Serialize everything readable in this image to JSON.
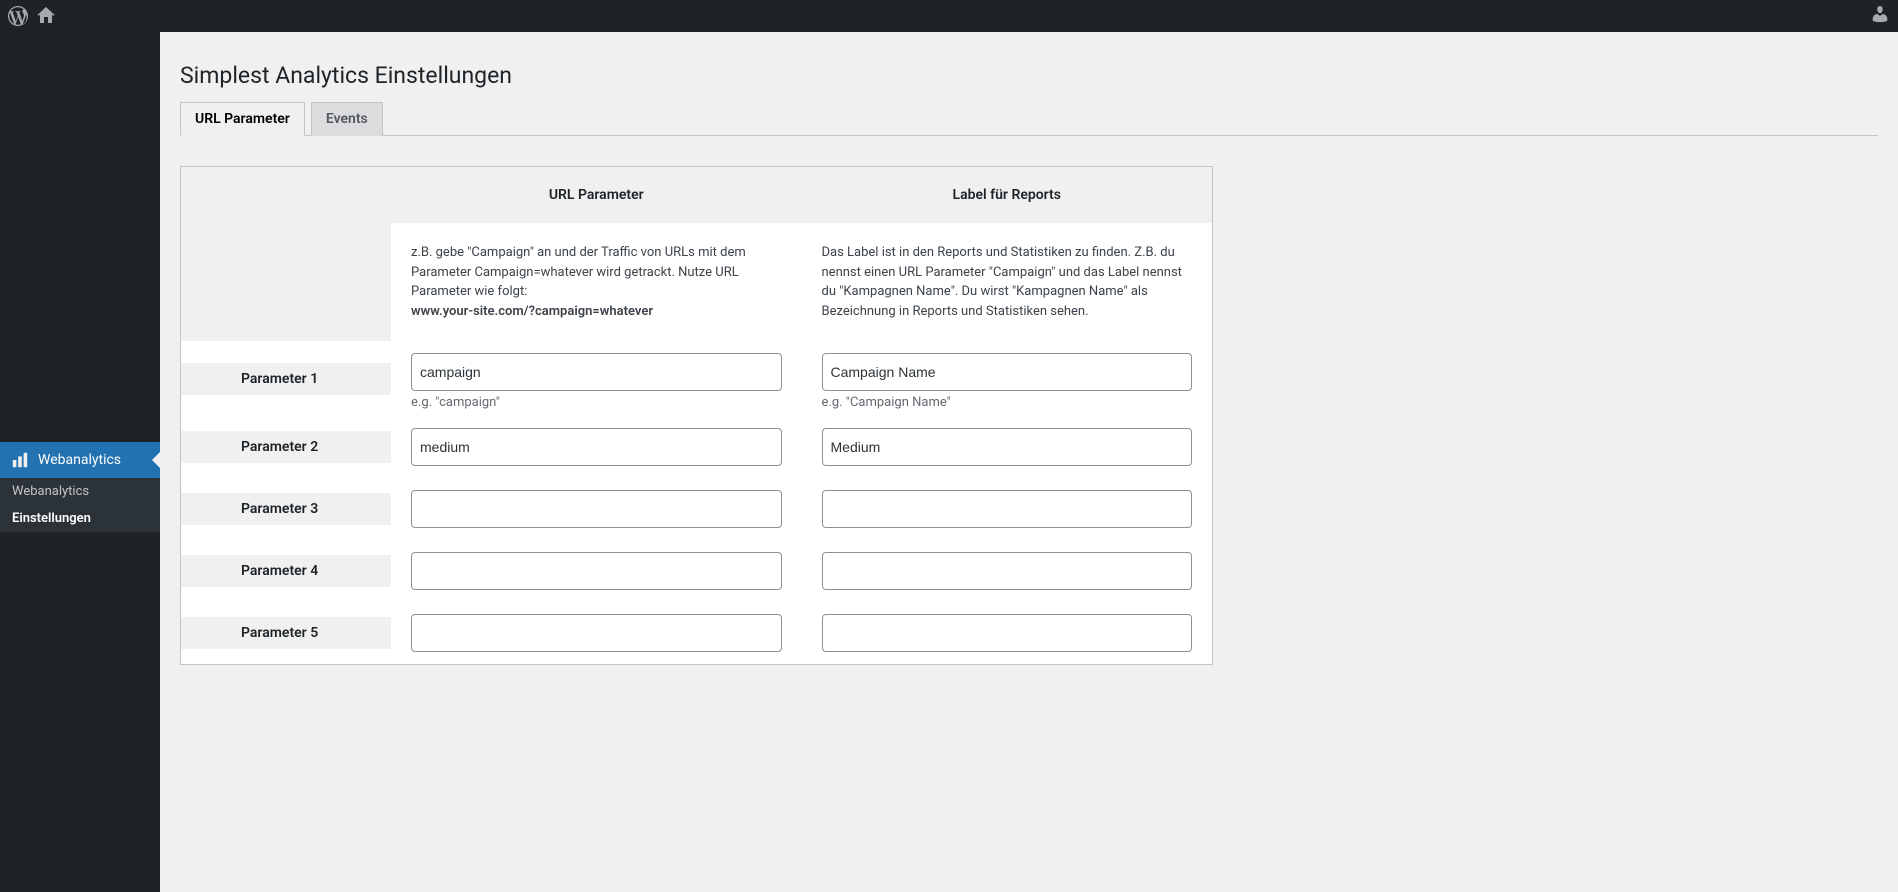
{
  "adminbar": {
    "wordpress_icon": "wordpress-logo-icon",
    "home_icon": "home-icon",
    "user_icon": "user-icon"
  },
  "sidebar": {
    "main_item": {
      "label": "Webanalytics"
    },
    "sub_items": [
      {
        "label": "Webanalytics",
        "current": false
      },
      {
        "label": "Einstellungen",
        "current": true
      }
    ]
  },
  "page": {
    "title": "Simplest Analytics Einstellungen"
  },
  "tabs": [
    {
      "label": "URL Parameter",
      "active": true
    },
    {
      "label": "Events",
      "active": false
    }
  ],
  "settings": {
    "header_url_param": "URL Parameter",
    "header_label": "Label für Reports",
    "desc_url_param": "z.B. gebe \"Campaign\" an und der Traffic von URLs mit dem Parameter Campaign=whatever wird getrackt. Nutze URL Parameter wie folgt:",
    "desc_url_example": "www.your-site.com/?campaign=whatever",
    "desc_label": "Das Label ist in den Reports und Statistiken zu finden. Z.B. du nennst einen URL Parameter \"Campaign\" und das Label nennst du \"Kampagnen Name\". Du wirst \"Kampagnen Name\" als Bezeichnung in Reports und Statistiken sehen.",
    "hint_url_param": "e.g. \"campaign\"",
    "hint_label": "e.g. \"Campaign Name\"",
    "rows": [
      {
        "label": "Parameter 1",
        "param": "campaign",
        "labelval": "Campaign Name"
      },
      {
        "label": "Parameter 2",
        "param": "medium",
        "labelval": "Medium"
      },
      {
        "label": "Parameter 3",
        "param": "",
        "labelval": ""
      },
      {
        "label": "Parameter 4",
        "param": "",
        "labelval": ""
      },
      {
        "label": "Parameter 5",
        "param": "",
        "labelval": ""
      }
    ]
  }
}
